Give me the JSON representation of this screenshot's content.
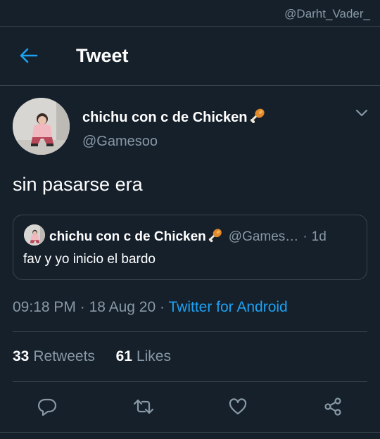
{
  "watermark": "@Darht_Vader_",
  "header": {
    "title": "Tweet"
  },
  "tweet": {
    "author_name": "chichu con c de Chicken",
    "author_handle": "@Gamesoo",
    "text": "sin pasarse era",
    "quoted": {
      "author_name": "chichu con c de Chicken",
      "author_handle": "@Games…",
      "separator": "·",
      "time": "1d",
      "text": "fav y yo inicio el bardo"
    },
    "time": "09:18 PM",
    "sep1": "·",
    "date": "18 Aug 20",
    "sep2": "·",
    "source": "Twitter for Android",
    "retweets_count": "33",
    "retweets_label": "Retweets",
    "likes_count": "61",
    "likes_label": "Likes"
  },
  "icons": {
    "back": "arrow-left-icon",
    "caret": "chevron-down-icon",
    "reply": "reply-icon",
    "retweet": "retweet-icon",
    "like": "heart-icon",
    "share": "share-icon",
    "name_emoji": "drumstick-icon"
  },
  "colors": {
    "background": "#15202b",
    "accent": "#1da1f2",
    "secondary_text": "#8899a6",
    "border": "#38444d"
  }
}
